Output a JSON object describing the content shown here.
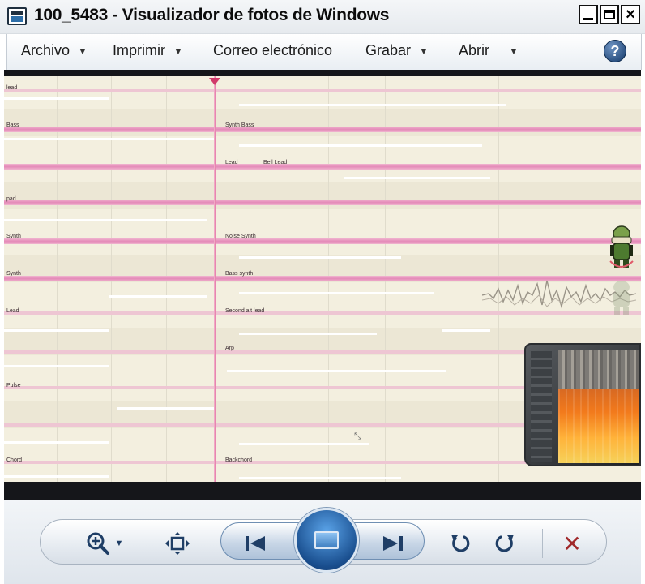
{
  "window": {
    "title": "100_5483 - Visualizador de fotos de Windows",
    "icon": "photo-viewer-icon",
    "controls": {
      "minimize": "minimize-icon",
      "maximize": "maximize-icon",
      "close": "×"
    }
  },
  "menu": {
    "items": [
      {
        "label": "Archivo",
        "has_dropdown": true
      },
      {
        "label": "Imprimir",
        "has_dropdown": true
      },
      {
        "label": "Correo electrónico",
        "has_dropdown": false
      },
      {
        "label": "Grabar",
        "has_dropdown": true
      },
      {
        "label": "Abrir",
        "has_dropdown": true
      }
    ],
    "caret": "▼",
    "help": "?"
  },
  "photo": {
    "track_labels": [
      "lead",
      "Bass",
      "Synth Bass",
      "Lead",
      "Bell Lead",
      "pad",
      "Synth",
      "Noise Synth",
      "Synth",
      "Bass synth",
      "Lead",
      "Second alt lead",
      "Arp",
      "Pulse",
      "Chord",
      "Backchord"
    ]
  },
  "toolbar": {
    "zoom_icon": "zoom-icon",
    "zoom_caret": "▼",
    "fit_icon": "fit-window-icon",
    "prev_icon": "previous-icon",
    "slideshow_icon": "slideshow-icon",
    "next_icon": "next-icon",
    "rotate_ccw_icon": "rotate-left-icon",
    "rotate_cw_icon": "rotate-right-icon",
    "delete_glyph": "✕"
  },
  "colors": {
    "track_band": "#e48ab8",
    "accent_blue": "#1a4f8f",
    "delete_red": "#a0282a"
  }
}
